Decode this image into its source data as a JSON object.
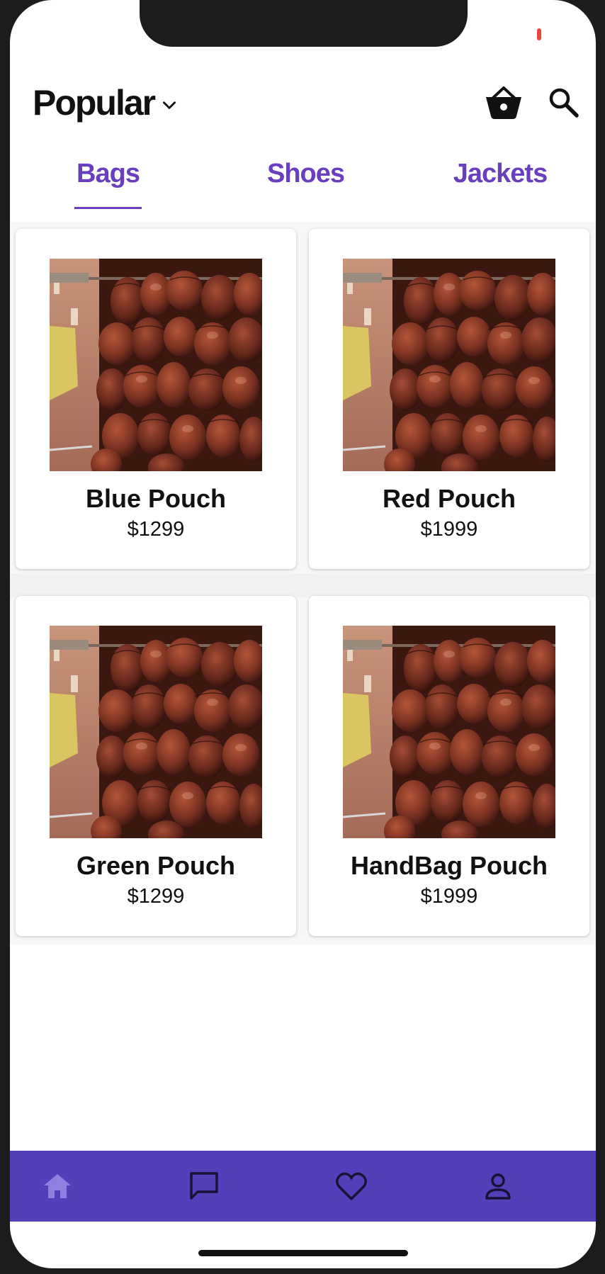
{
  "header": {
    "title": "Popular"
  },
  "tabs": [
    {
      "label": "Bags",
      "active": true
    },
    {
      "label": "Shoes",
      "active": false
    },
    {
      "label": "Jackets",
      "active": false
    }
  ],
  "products": [
    {
      "name": "Blue Pouch",
      "price": "$1299"
    },
    {
      "name": "Red Pouch",
      "price": "$1999"
    },
    {
      "name": "Green Pouch",
      "price": "$1299"
    },
    {
      "name": "HandBag Pouch",
      "price": "$1999"
    }
  ],
  "icons": {
    "title_dropdown": "chevron-down-icon",
    "cart": "basket-icon",
    "search": "search-icon",
    "nav": [
      "home-icon",
      "chat-icon",
      "heart-icon",
      "person-icon"
    ]
  },
  "colors": {
    "accent": "#6a3fbf",
    "bottom_nav": "#5340b8",
    "nav_active_icon": "#8f80e0",
    "recording_dot": "#e8473a"
  }
}
